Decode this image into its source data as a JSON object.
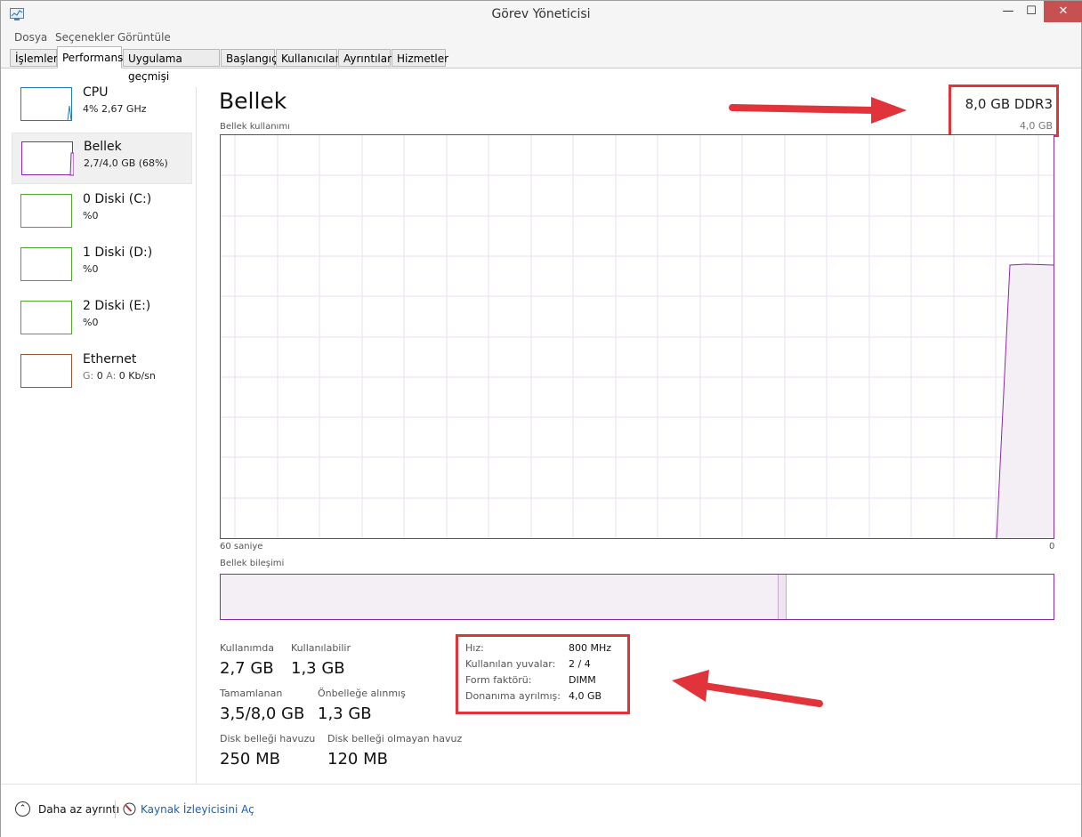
{
  "window": {
    "title": "Görev Yöneticisi",
    "controls": {
      "minimize": "—",
      "maximize": "☐",
      "close": "✕"
    }
  },
  "menu": [
    "Dosya",
    "Seçenekler",
    "Görüntüle"
  ],
  "tabs": [
    {
      "label": "İşlemler",
      "active": false
    },
    {
      "label": "Performans",
      "active": true
    },
    {
      "label": "Uygulama geçmişi",
      "active": false
    },
    {
      "label": "Başlangıç",
      "active": false
    },
    {
      "label": "Kullanıcılar",
      "active": false
    },
    {
      "label": "Ayrıntılar",
      "active": false
    },
    {
      "label": "Hizmetler",
      "active": false
    }
  ],
  "sidebar": {
    "items": [
      {
        "name": "CPU",
        "sub": "4% 2,67 GHz",
        "color": "#1f7fb3",
        "active": false
      },
      {
        "name": "Bellek",
        "sub": "2,7/4,0 GB (68%)",
        "color": "#8b2aa7",
        "active": true
      },
      {
        "name": "0 Diski (C:)",
        "sub": "%0",
        "color": "#4caa2a",
        "active": false
      },
      {
        "name": "1 Diski (D:)",
        "sub": "%0",
        "color": "#4caa2a",
        "active": false
      },
      {
        "name": "2 Diski (E:)",
        "sub": "%0",
        "color": "#4caa2a",
        "active": false
      },
      {
        "name": "Ethernet",
        "sub_label_g": "G:",
        "sub_g": "0",
        "sub_label_a": "A:",
        "sub_a": "0 Kb/sn",
        "color": "#a0522d",
        "active": false
      }
    ]
  },
  "main": {
    "title": "Bellek",
    "spec": "8,0 GB DDR3",
    "total": "4,0 GB",
    "usage_label": "Bellek kullanımı",
    "axis_left": "60 saniye",
    "axis_right": "0",
    "composition_label": "Bellek bileşimi",
    "composition": {
      "in_use_fraction": 0.67,
      "modified_fraction": 0.01
    },
    "stats": {
      "in_use_label": "Kullanımda",
      "in_use": "2,7 GB",
      "available_label": "Kullanılabilir",
      "available": "1,3 GB",
      "committed_label": "Tamamlanan",
      "committed": "3,5/8,0 GB",
      "cached_label": "Önbelleğe alınmış",
      "cached": "1,3 GB",
      "paged_label": "Disk belleği havuzu",
      "paged": "250 MB",
      "nonpaged_label": "Disk belleği olmayan havuz",
      "nonpaged": "120 MB"
    },
    "details": [
      {
        "label": "Hız:",
        "value": "800 MHz"
      },
      {
        "label": "Kullanılan yuvalar:",
        "value": "2 / 4"
      },
      {
        "label": "Form faktörü:",
        "value": "DIMM"
      },
      {
        "label": "Donanıma ayrılmış:",
        "value": "4,0 GB"
      }
    ]
  },
  "footer": {
    "less_details": "Daha az ayrıntı",
    "resource_monitor": "Kaynak İzleyicisini Aç"
  },
  "colors": {
    "memory": "#8b2aa7",
    "cpu": "#1f7fb3",
    "disk": "#4caa2a",
    "ethernet": "#a0522d",
    "annotation": "#e0343a"
  }
}
